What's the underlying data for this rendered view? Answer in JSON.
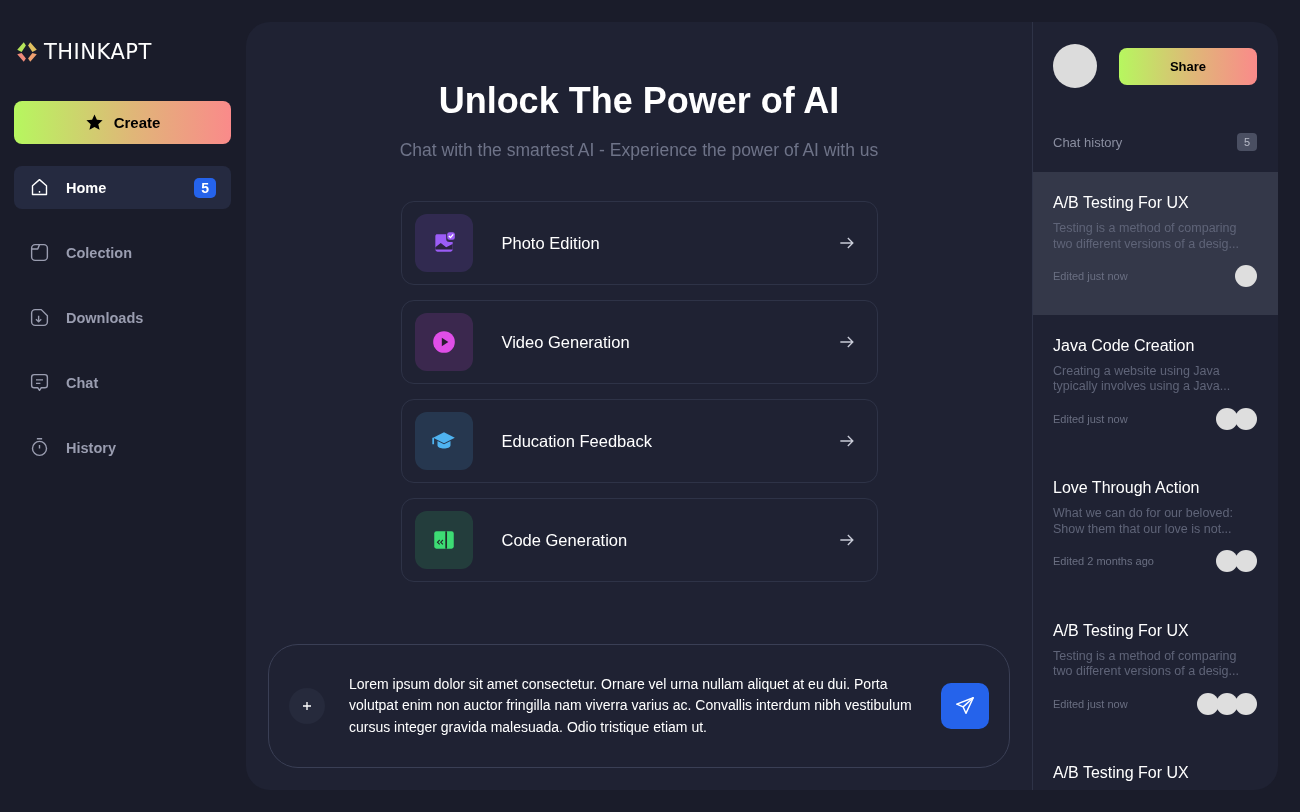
{
  "logo": {
    "text": "THINKAPT"
  },
  "create_button": {
    "label": "Create"
  },
  "sidebar": {
    "items": [
      {
        "kind": "home",
        "label": "Home",
        "selected": true,
        "badge": "5"
      },
      {
        "kind": "folder",
        "label": "Colection",
        "selected": false
      },
      {
        "kind": "download",
        "label": "Downloads",
        "selected": false
      },
      {
        "kind": "chat",
        "label": "Chat",
        "selected": false
      },
      {
        "kind": "timer",
        "label": "History",
        "selected": false
      }
    ]
  },
  "hero": {
    "title": "Unlock The Power of AI",
    "subtitle": "Chat with the smartest AI - Experience the power of AI with us"
  },
  "features": [
    {
      "kind": "photo",
      "label": "Photo Edition",
      "color": "#9b5cf6"
    },
    {
      "kind": "video",
      "label": "Video Generation",
      "color": "#e04ee8"
    },
    {
      "kind": "education",
      "label": "Education Feedback",
      "color": "#4fb3f0"
    },
    {
      "kind": "code",
      "label": "Code Generation",
      "color": "#3ddc74"
    }
  ],
  "composer": {
    "value": "Lorem ipsum dolor sit amet consectetur. Ornare vel urna nullam aliquet at eu dui. Porta volutpat enim non auctor fringilla nam viverra varius ac. Convallis interdum nibh vestibulum cursus integer gravida malesuada. Odio tristique etiam ut."
  },
  "share_button": {
    "label": "Share"
  },
  "chat_history": {
    "heading": "Chat history",
    "count": "5",
    "items": [
      {
        "title": "A/B Testing For UX",
        "preview": "Testing is a method of comparing two different versions of a desig...",
        "edited": "Edited just now",
        "selected": true,
        "avatars": [
          {
            "kind": "circle"
          }
        ]
      },
      {
        "title": "Java Code Creation",
        "preview": "Creating a website using Java typically involves using a Java...",
        "edited": "Edited just now",
        "selected": false,
        "avatars": [
          {
            "kind": "circle"
          },
          {
            "kind": "circle"
          }
        ]
      },
      {
        "title": "Love Through Action",
        "preview": "What we can do for our beloved: Show them that our love is not...",
        "edited": "Edited 2 months ago",
        "selected": false,
        "avatars": [
          {
            "kind": "circle"
          },
          {
            "kind": "circle"
          }
        ]
      },
      {
        "title": "A/B Testing For UX",
        "preview": "Testing is a method of comparing two different versions of a desig...",
        "edited": "Edited just now",
        "selected": false,
        "avatars": [
          {
            "kind": "circle"
          },
          {
            "kind": "circle"
          },
          {
            "kind": "circle"
          }
        ]
      },
      {
        "title": "A/B Testing For UX",
        "selected": false
      }
    ]
  }
}
